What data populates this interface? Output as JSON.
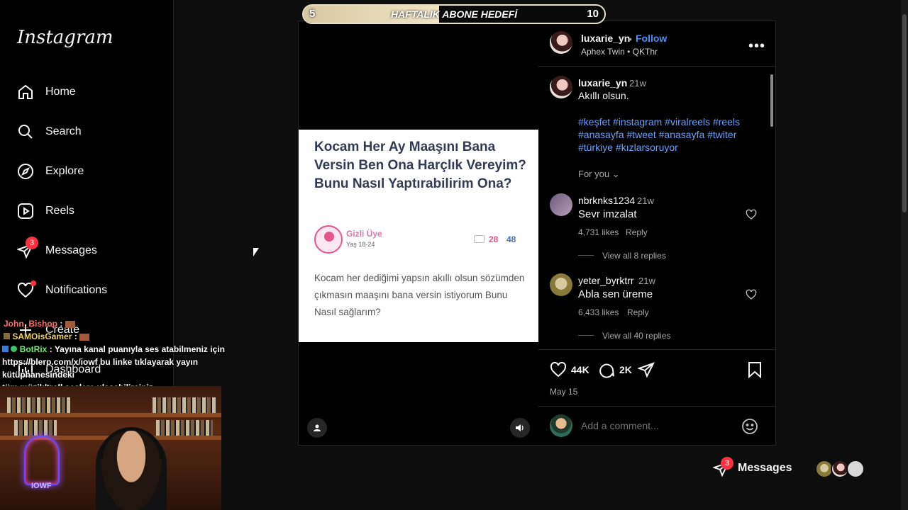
{
  "sidebar": {
    "logo": "Instagram",
    "items": [
      {
        "label": "Home",
        "icon": "home-icon"
      },
      {
        "label": "Search",
        "icon": "search-icon"
      },
      {
        "label": "Explore",
        "icon": "compass-icon"
      },
      {
        "label": "Reels",
        "icon": "reels-icon"
      },
      {
        "label": "Messages",
        "icon": "messenger-icon",
        "badge": "3"
      },
      {
        "label": "Notifications",
        "icon": "heart-icon"
      },
      {
        "label": "Create",
        "icon": "plus-icon"
      },
      {
        "label": "Dashboard",
        "icon": "dashboard-icon"
      }
    ]
  },
  "goal": {
    "start": "5",
    "title": "HAFTALIK ABONE HEDEFİ",
    "end": "10",
    "progress_fraction": 0.45
  },
  "video": {
    "screenshot_title": "Kocam Her Ay Maaşını Bana Versin Ben Ona Harçlık Vereyim? Bunu Nasıl Yaptırabilirim Ona?",
    "poster_name": "Gizli Üye",
    "poster_age": "Yaş 18-24",
    "count_comments": "28",
    "count_views": "48",
    "body": "Kocam her dediğimi yapsın akıllı olsun sözümden çıkmasın maaşını bana versin istiyorum Bunu Nasıl sağlarım?"
  },
  "post": {
    "username": "luxarie_yn",
    "follow": "Follow",
    "audio": "Aphex Twin • QKThr",
    "caption_time": "21w",
    "caption": "Akıllı olsun.",
    "hashtags": "#keşfet #instagram #viralreels #reels #anasayfa #tweet #anasayfa #twiter #türkiye #kızlarsoruyor",
    "for_you": "For you",
    "comments": [
      {
        "user": "nbrknks1234",
        "time": "21w",
        "text": "Sevr imzalat",
        "likes": "4,731 likes",
        "reply": "Reply",
        "view_replies": "View all 8 replies"
      },
      {
        "user": "yeter_byrktrr",
        "time": "21w",
        "text": "Abla sen üreme",
        "likes": "6,433 likes",
        "reply": "Reply",
        "view_replies": "View all 40 replies"
      }
    ],
    "like_count": "44K",
    "comment_count": "2K",
    "date": "May 15",
    "add_comment_placeholder": "Add a comment..."
  },
  "bottom_messages": {
    "label": "Messages",
    "badge": "3"
  },
  "stream_chat": {
    "lines": [
      {
        "user": "John_Bishop",
        "text": ":"
      },
      {
        "user": "SAMOisGamer",
        "text": ":"
      },
      {
        "user": "BotRix",
        "text": ": Yayına kanal puanıyla ses atabilmeniz için"
      },
      {
        "user": "",
        "text": "https://blerp.com/x/iowf bu linke tıklayarak yayın kütüphanesindeki"
      },
      {
        "user": "",
        "text": "tüm müzik/troll seslere ulaşabilirsiniz."
      }
    ],
    "cam_neon": "IOWF"
  },
  "colors": {
    "accent": "#4a90f6",
    "badge": "#ff3040",
    "hashtag": "#6aa1f8"
  }
}
